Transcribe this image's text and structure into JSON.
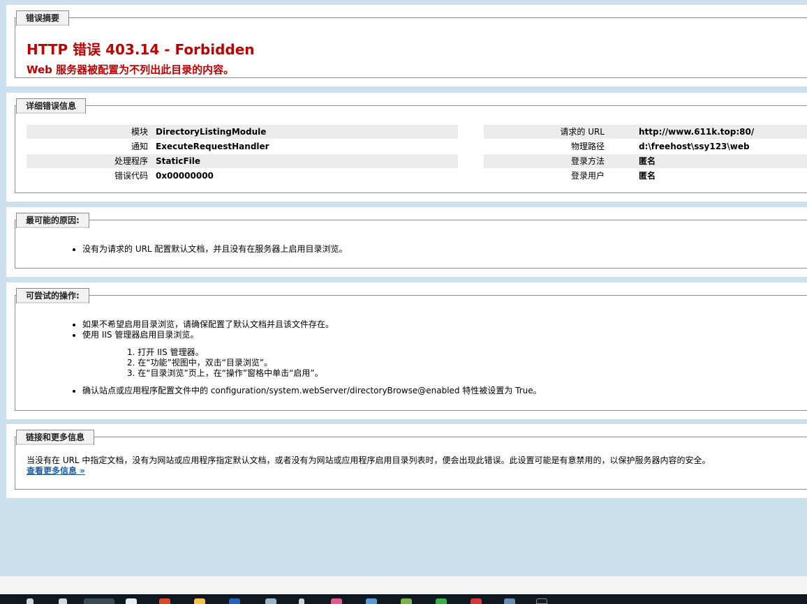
{
  "summary": {
    "legend": "错误摘要",
    "title": "HTTP 错误 403.14 - Forbidden",
    "subtitle": "Web 服务器被配置为不列出此目录的内容。"
  },
  "details": {
    "legend": "详细错误信息",
    "left": [
      {
        "label": "模块",
        "value": "DirectoryListingModule"
      },
      {
        "label": "通知",
        "value": "ExecuteRequestHandler"
      },
      {
        "label": "处理程序",
        "value": "StaticFile"
      },
      {
        "label": "错误代码",
        "value": "0x00000000"
      }
    ],
    "right": [
      {
        "label": "请求的 URL",
        "value": "http://www.611k.top:80/"
      },
      {
        "label": "物理路径",
        "value": "d:\\freehost\\ssy123\\web"
      },
      {
        "label": "登录方法",
        "value": "匿名"
      },
      {
        "label": "登录用户",
        "value": "匿名"
      }
    ]
  },
  "causes": {
    "legend": "最可能的原因:",
    "items": [
      "没有为请求的 URL 配置默认文档，并且没有在服务器上启用目录浏览。"
    ]
  },
  "actions": {
    "legend": "可尝试的操作:",
    "items": [
      "如果不希望启用目录浏览，请确保配置了默认文档并且该文件存在。",
      "使用 IIS 管理器启用目录浏览。"
    ],
    "steps": [
      "1. 打开 IIS 管理器。",
      "2. 在“功能”视图中，双击“目录浏览”。",
      "3. 在“目录浏览”页上，在“操作”窗格中单击“启用”。"
    ],
    "last_item": "确认站点或应用程序配置文件中的 configuration/system.webServer/directoryBrowse@enabled 特性被设置为 True。"
  },
  "links": {
    "legend": "链接和更多信息",
    "text": "当没有在 URL 中指定文档，没有为网站或应用程序指定默认文档，或者没有为网站或应用程序启用目录列表时，便会出现此错误。此设置可能是有意禁用的，以保护服务器内容的安全。",
    "more_label": "查看更多信息 »"
  },
  "colors": {
    "page_bg": "#cce0ee",
    "error_red": "#c00000",
    "link_blue": "#1d5ea8",
    "taskbar": "#101820"
  }
}
